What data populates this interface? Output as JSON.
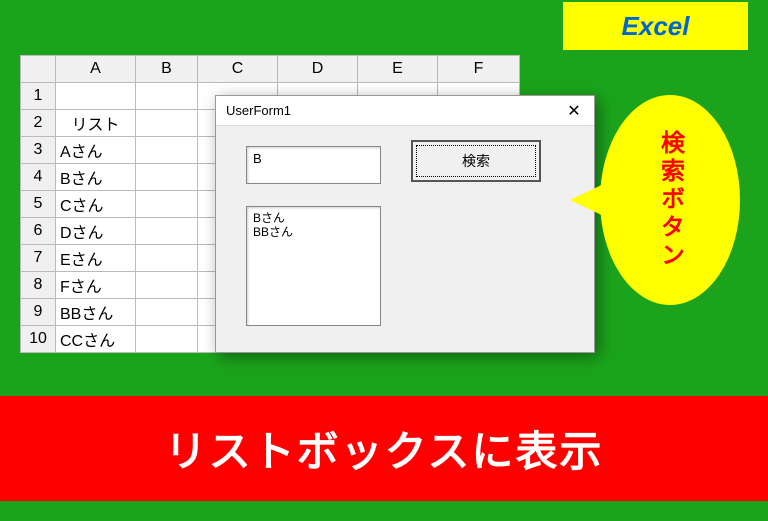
{
  "topBadge": "Excel",
  "sheet": {
    "cols": [
      "A",
      "B",
      "C",
      "D",
      "E",
      "F"
    ],
    "rows": [
      "1",
      "2",
      "3",
      "4",
      "5",
      "6",
      "7",
      "8",
      "9",
      "10"
    ],
    "a2": "リスト",
    "a3": "Aさん",
    "a4": "Bさん",
    "a5": "Cさん",
    "a6": "Dさん",
    "a7": "Eさん",
    "a8": "Fさん",
    "a9": "BBさん",
    "a10": "CCさん"
  },
  "userform": {
    "title": "UserForm1",
    "closeGlyph": "✕",
    "inputValue": "B",
    "searchButton": "検索",
    "listItems": {
      "0": "Bさん",
      "1": "BBさん"
    }
  },
  "bubble": "検索ボタン",
  "bottomBanner": "リストボックスに表示"
}
